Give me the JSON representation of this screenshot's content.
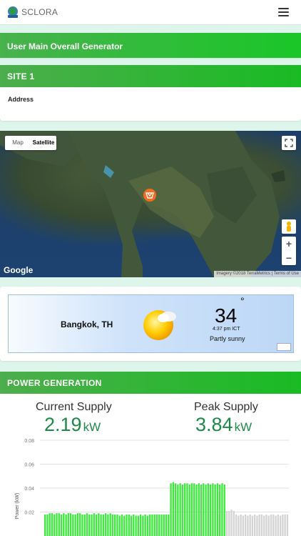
{
  "header": {
    "brand": "SCLORA",
    "menu_icon": "hamburger-icon"
  },
  "banner": {
    "title": "User Main Overall Generator"
  },
  "site": {
    "title": "SITE 1",
    "address_label": "Address"
  },
  "map": {
    "map_label": "Map",
    "satellite_label": "Satellite",
    "selected": "Satellite",
    "zoom_in": "+",
    "zoom_out": "−",
    "google_logo": "Google",
    "attribution": "Imagery ©2018 TerraMetrics  |  Terms of Use"
  },
  "weather": {
    "city": "Bangkok, TH",
    "temp": "34",
    "degree": "°",
    "time": "4:37 pm ICT",
    "condition": "Partly sunny",
    "icon": "partly-sunny-icon"
  },
  "power": {
    "title": "POWER GENERATION",
    "current_label": "Current Supply",
    "current_value": "2.19",
    "current_unit": "kW",
    "peak_label": "Peak Supply",
    "peak_value": "3.84",
    "peak_unit": "kW"
  },
  "colors": {
    "accent": "#19bb23",
    "value_green": "#1d8a4a",
    "bar_green": "#3ee83e",
    "bar_grey": "#d4d4d4"
  },
  "chart_data": {
    "type": "bar",
    "ylabel": "Power (kW)",
    "yticks": [
      "0.08",
      "0.06",
      "0.04",
      "0.02"
    ],
    "ylim": [
      0,
      0.08
    ],
    "series": [
      {
        "values": [
          0.018,
          0.018,
          0.019,
          0.019,
          0.018,
          0.019,
          0.019,
          0.018,
          0.019,
          0.018,
          0.019,
          0.019,
          0.018,
          0.018,
          0.019,
          0.019,
          0.018,
          0.018,
          0.019,
          0.018,
          0.018,
          0.019,
          0.018,
          0.019,
          0.018,
          0.018,
          0.019,
          0.018,
          0.019,
          0.018,
          0.018,
          0.018,
          0.017,
          0.018,
          0.017,
          0.018,
          0.018,
          0.017,
          0.018,
          0.017,
          0.017,
          0.018,
          0.017,
          0.018,
          0.017,
          0.018,
          0.018,
          0.018,
          0.018,
          0.018,
          0.018,
          0.018,
          0.018,
          0.018,
          0.044,
          0.045,
          0.044,
          0.043,
          0.044,
          0.043,
          0.044,
          0.044,
          0.043,
          0.044,
          0.044,
          0.043,
          0.044,
          0.043,
          0.044,
          0.043,
          0.044,
          0.043,
          0.044,
          0.043,
          0.044,
          0.043,
          0.044,
          0.043
        ],
        "color": "#3ee83e"
      },
      {
        "values": [
          0.021,
          0.021,
          0.022,
          0.021,
          0.018,
          0.017,
          0.018,
          0.017,
          0.018,
          0.017,
          0.018,
          0.017,
          0.018,
          0.017,
          0.018,
          0.018,
          0.017,
          0.018,
          0.017,
          0.018,
          0.018,
          0.017,
          0.018,
          0.017,
          0.018,
          0.018,
          0.018
        ],
        "color": "#d4d4d4"
      }
    ]
  }
}
